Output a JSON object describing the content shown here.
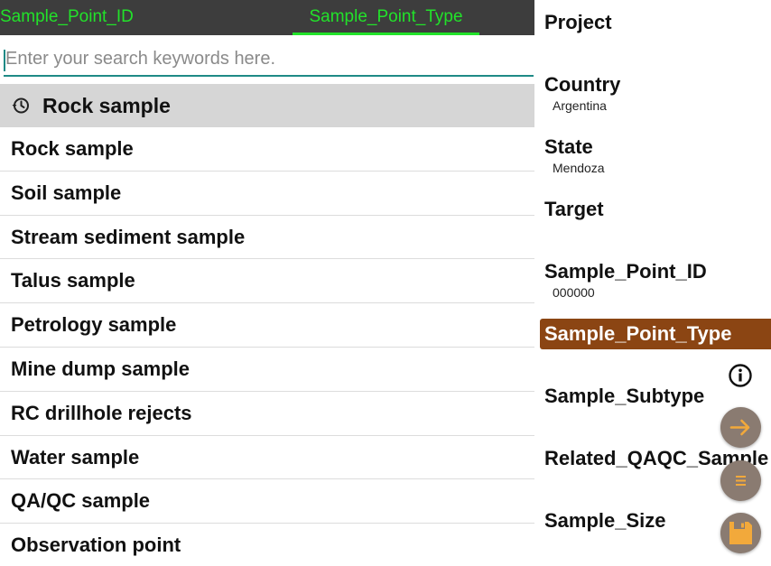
{
  "tabs": [
    {
      "label": "Sample_Point_ID"
    },
    {
      "label": "Sample_Point_Type"
    }
  ],
  "search": {
    "placeholder": "Enter your search keywords here.",
    "value": ""
  },
  "history": {
    "icon": "history-icon",
    "label": "Rock sample"
  },
  "options": [
    "Rock sample",
    "Soil sample",
    "Stream sediment sample",
    "Talus sample",
    "Petrology sample",
    "Mine dump sample",
    "RC drillhole rejects",
    "Water sample",
    "QA/QC sample",
    "Observation point"
  ],
  "form": {
    "fields": [
      {
        "label": "Project",
        "value": ""
      },
      {
        "label": "Country",
        "value": "Argentina"
      },
      {
        "label": "State",
        "value": "Mendoza"
      },
      {
        "label": "Target",
        "value": ""
      },
      {
        "label": "Sample_Point_ID",
        "value": "000000"
      },
      {
        "label": "Sample_Point_Type",
        "value": "",
        "active": true
      },
      {
        "label": "Sample_Subtype",
        "value": ""
      },
      {
        "label": "Related_QAQC_Sample",
        "value": ""
      },
      {
        "label": "Sample_Size",
        "value": ""
      }
    ]
  },
  "icons": {
    "info": "info-icon",
    "next": "arrow-right-icon",
    "menu": "menu-list-icon",
    "save": "save-icon"
  },
  "colors": {
    "tab_text": "#22e22a",
    "tab_bar": "#3d3d3d",
    "search_underline": "#1f8a86",
    "active_field": "#8b4513",
    "fab_bg": "#8a7b71",
    "fab_icon": "#f2a93b"
  }
}
